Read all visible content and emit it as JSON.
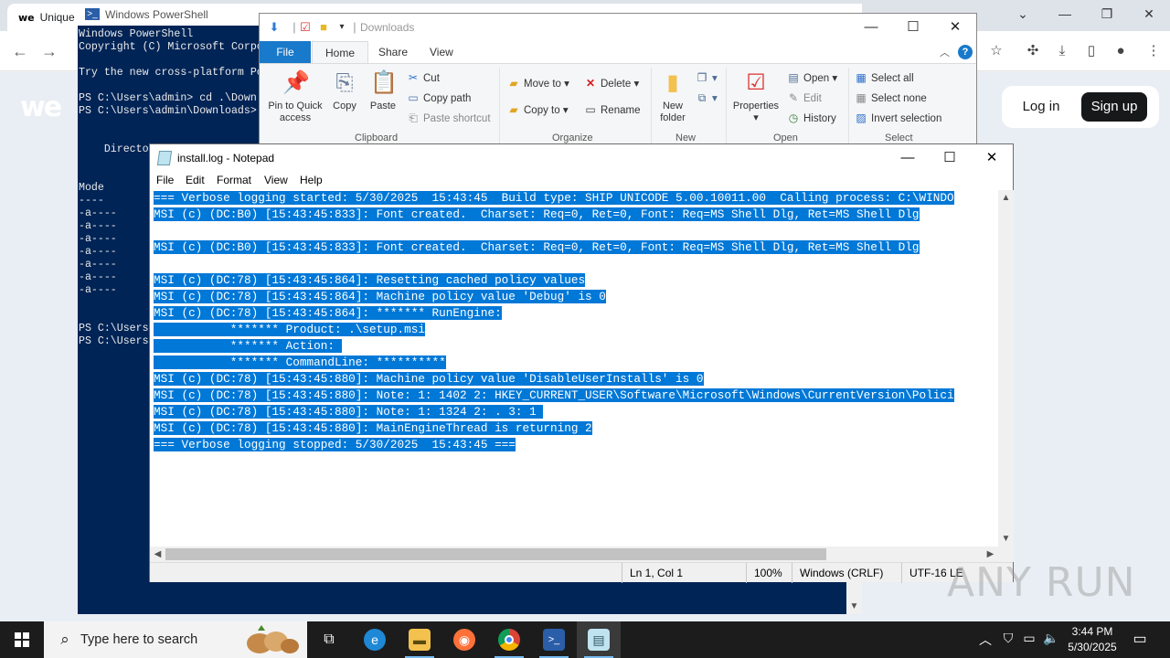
{
  "browser": {
    "tab_title": "Unique",
    "tab_logo": "we",
    "page_logo": "we",
    "login_label": "Log in",
    "signup_label": "Sign up",
    "icons": [
      "back-icon",
      "forward-icon",
      "star-icon",
      "extensions-icon",
      "download-icon",
      "sidepanel-icon",
      "profile-icon",
      "menu-icon"
    ]
  },
  "powershell": {
    "title": "Windows PowerShell",
    "lines": [
      "Windows PowerShell",
      "Copyright (C) Microsoft Corpo",
      "",
      "Try the new cross-platform Po",
      "",
      "PS C:\\Users\\admin> cd .\\Down",
      "PS C:\\Users\\admin\\Downloads>",
      "",
      "",
      "    Directo",
      "",
      "",
      "Mode",
      "----",
      "-a----",
      "-a----",
      "-a----",
      "-a----",
      "-a----",
      "-a----",
      "-a----",
      "",
      "",
      "PS C:\\Users",
      "PS C:\\Users"
    ]
  },
  "explorer": {
    "title": "Downloads",
    "tabs": {
      "file": "File",
      "home": "Home",
      "share": "Share",
      "view": "View"
    },
    "clipboard": {
      "pin": "Pin to Quick access",
      "copy": "Copy",
      "paste": "Paste",
      "cut": "Cut",
      "copy_path": "Copy path",
      "paste_shortcut": "Paste shortcut",
      "label": "Clipboard"
    },
    "organize": {
      "move_to": "Move to",
      "copy_to": "Copy to",
      "delete": "Delete",
      "rename": "Rename",
      "label": "Organize"
    },
    "new": {
      "new_folder": "New folder",
      "label": "New"
    },
    "open": {
      "properties": "Properties",
      "open": "Open",
      "edit": "Edit",
      "history": "History",
      "label": "Open"
    },
    "select": {
      "select_all": "Select all",
      "select_none": "Select none",
      "invert": "Invert selection",
      "label": "Select"
    }
  },
  "notepad": {
    "title": "install.log - Notepad",
    "menu": {
      "file": "File",
      "edit": "Edit",
      "format": "Format",
      "view": "View",
      "help": "Help"
    },
    "lines": [
      "=== Verbose logging started: 5/30/2025  15:43:45  Build type: SHIP UNICODE 5.00.10011.00  Calling process: C:\\WINDO",
      "MSI (c) (DC:B0) [15:43:45:833]: Font created.  Charset: Req=0, Ret=0, Font: Req=MS Shell Dlg, Ret=MS Shell Dlg",
      "",
      "MSI (c) (DC:B0) [15:43:45:833]: Font created.  Charset: Req=0, Ret=0, Font: Req=MS Shell Dlg, Ret=MS Shell Dlg",
      "",
      "MSI (c) (DC:78) [15:43:45:864]: Resetting cached policy values",
      "MSI (c) (DC:78) [15:43:45:864]: Machine policy value 'Debug' is 0",
      "MSI (c) (DC:78) [15:43:45:864]: ******* RunEngine:",
      "           ******* Product: .\\setup.msi",
      "           ******* Action: ",
      "           ******* CommandLine: **********",
      "MSI (c) (DC:78) [15:43:45:880]: Machine policy value 'DisableUserInstalls' is 0",
      "MSI (c) (DC:78) [15:43:45:880]: Note: 1: 1402 2: HKEY_CURRENT_USER\\Software\\Microsoft\\Windows\\CurrentVersion\\Polici",
      "MSI (c) (DC:78) [15:43:45:880]: Note: 1: 1324 2: . 3: 1 ",
      "MSI (c) (DC:78) [15:43:45:880]: MainEngineThread is returning 2",
      "=== Verbose logging stopped: 5/30/2025  15:43:45 ==="
    ],
    "status": {
      "position": "Ln 1, Col 1",
      "zoom": "100%",
      "line_ending": "Windows (CRLF)",
      "encoding": "UTF-16 LE"
    }
  },
  "watermark": "ANY RUN",
  "taskbar": {
    "search_placeholder": "Type here to search",
    "clock_time": "3:44 PM",
    "clock_date": "5/30/2025",
    "apps": [
      "task-view-icon",
      "edge-icon",
      "file-explorer-icon",
      "firefox-icon",
      "chrome-icon",
      "powershell-icon",
      "notepad-icon"
    ]
  },
  "colors": {
    "selection": "#0078d7",
    "powershell_bg": "#012456",
    "ribbon_file_tab": "#1979ca",
    "taskbar": "#1c1c1c"
  }
}
